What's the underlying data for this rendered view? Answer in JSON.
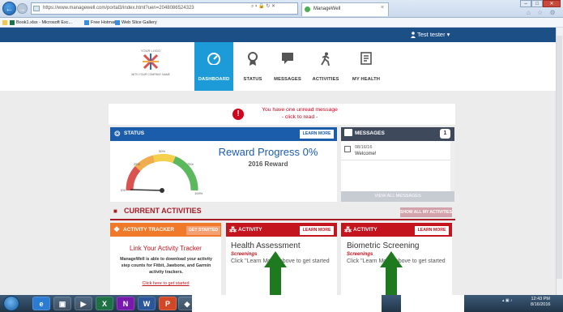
{
  "browser": {
    "url": "https://www.managewell.com/portal3/index.html?uen=2048086524323",
    "url_tools": "⌕ ▾ 🔒 ↻ ✕",
    "tab_title": "ManageWell",
    "tab_close": "×",
    "favorites": [
      {
        "label": "Book1.xlsx - Microsoft Exc..."
      },
      {
        "label": "Free Hotmail"
      },
      {
        "label": "Web Slice Gallery"
      }
    ],
    "window": {
      "min": "–",
      "max": "□",
      "close": "✕"
    },
    "home_star": "⌂ ☆ ⚙"
  },
  "header": {
    "user": "Test tester ▾",
    "logo_top": "YOUR LOGO",
    "logo_bottom": "WITH YOUR COMPANY NAME",
    "nav": [
      {
        "label": "DASHBOARD",
        "icon": "dashboard-icon",
        "glyph": "◔"
      },
      {
        "label": "STATUS",
        "icon": "medal-icon",
        "glyph": "❂"
      },
      {
        "label": "MESSAGES",
        "icon": "chat-icon",
        "glyph": "■"
      },
      {
        "label": "ACTIVITIES",
        "icon": "runner-icon",
        "glyph": "ༀ"
      },
      {
        "label": "MY HEALTH",
        "icon": "clipboard-icon",
        "glyph": "☷"
      }
    ]
  },
  "alert": {
    "icon": "!",
    "line1": "You have one unread message",
    "line2": "- click to read -"
  },
  "status": {
    "title": "STATUS",
    "learn_more": "LEARN MORE",
    "reward_title": "Reward Progress 0%",
    "reward_sub": "2016 Reward",
    "progress": 0,
    "gauge_labels": [
      "0%",
      "25%",
      "50%",
      "75%",
      "100%"
    ]
  },
  "messages": {
    "title": "MESSAGES",
    "count": "1",
    "items": [
      {
        "date": "08/16/16",
        "text": "Welcome!"
      }
    ],
    "view_all": "VIEW ALL MESSAGES"
  },
  "activities": {
    "title": "CURRENT ACTIVITIES",
    "show_all": "SHOW ALL MY ACTIVITIES",
    "tracker": {
      "title": "ACTIVITY TRACKER",
      "button": "GET STARTED",
      "link": "Link Your Activity Tracker",
      "desc": "ManageWell is able to download your activity step counts for Fitbit, Jawbone, and Garmin activity trackers.",
      "click": "Click here to get started"
    },
    "cards": [
      {
        "head": "ACTIVITY",
        "button": "LEARN MORE",
        "title": "Health Assessment",
        "sub": "Screenings",
        "desc": "Click \"Learn More\" above to get started"
      },
      {
        "head": "ACTIVITY",
        "button": "LEARN MORE",
        "title": "Biometric Screening",
        "sub": "Screenings",
        "desc": "Click \"Learn More\" above to get started"
      }
    ]
  },
  "taskbar": {
    "apps": [
      "e",
      "▣",
      "▶",
      "X",
      "N",
      "W",
      "P",
      "◆"
    ],
    "tray": "▴ ▣ ♪",
    "time": "12:43 PM",
    "date": "8/16/2016"
  }
}
